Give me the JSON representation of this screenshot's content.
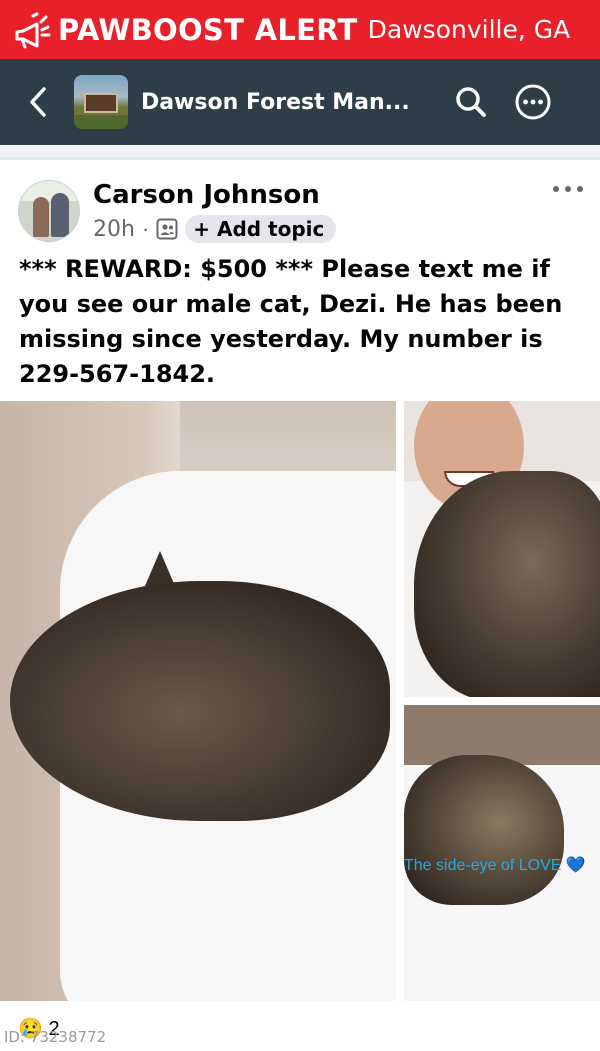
{
  "alert": {
    "brand": "PAWBOOST ALERT",
    "location": "Dawsonville, GA",
    "icon": "megaphone-icon",
    "color": "#e8202a"
  },
  "topbar": {
    "group_name": "Dawson Forest Man...",
    "back_icon": "chevron-left-icon",
    "search_icon": "search-icon",
    "more_icon": "more-horizontal-icon",
    "color": "#2d3e48"
  },
  "post": {
    "author": "Carson Johnson",
    "time": "20h",
    "separator": "·",
    "audience_icon": "group-audience-icon",
    "topic_chip": "+ Add topic",
    "text": "*** REWARD: $500 *** Please text me if you see our male cat, Dezi.  He has been missing since yesterday.  My number is 229-567-1842.",
    "photo_caption": "The side-eye of LOVE 💙",
    "reaction_emoji": "😢 2"
  },
  "footer": {
    "id_label": "ID: 73238772"
  }
}
